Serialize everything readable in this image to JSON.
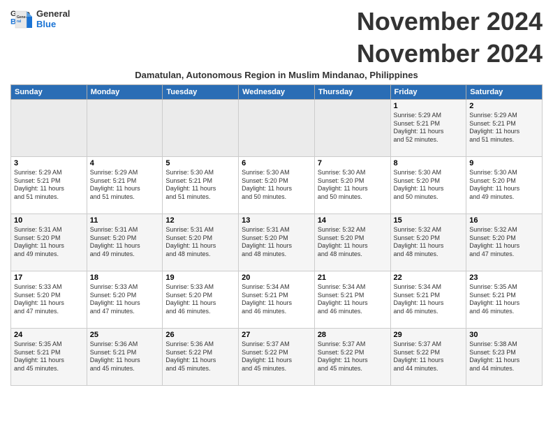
{
  "header": {
    "logo_general": "General",
    "logo_blue": "Blue",
    "month_title": "November 2024",
    "subtitle": "Damatulan, Autonomous Region in Muslim Mindanao, Philippines"
  },
  "weekdays": [
    "Sunday",
    "Monday",
    "Tuesday",
    "Wednesday",
    "Thursday",
    "Friday",
    "Saturday"
  ],
  "weeks": [
    [
      {
        "day": "",
        "info": ""
      },
      {
        "day": "",
        "info": ""
      },
      {
        "day": "",
        "info": ""
      },
      {
        "day": "",
        "info": ""
      },
      {
        "day": "",
        "info": ""
      },
      {
        "day": "1",
        "info": "Sunrise: 5:29 AM\nSunset: 5:21 PM\nDaylight: 11 hours\nand 52 minutes."
      },
      {
        "day": "2",
        "info": "Sunrise: 5:29 AM\nSunset: 5:21 PM\nDaylight: 11 hours\nand 51 minutes."
      }
    ],
    [
      {
        "day": "3",
        "info": "Sunrise: 5:29 AM\nSunset: 5:21 PM\nDaylight: 11 hours\nand 51 minutes."
      },
      {
        "day": "4",
        "info": "Sunrise: 5:29 AM\nSunset: 5:21 PM\nDaylight: 11 hours\nand 51 minutes."
      },
      {
        "day": "5",
        "info": "Sunrise: 5:30 AM\nSunset: 5:21 PM\nDaylight: 11 hours\nand 51 minutes."
      },
      {
        "day": "6",
        "info": "Sunrise: 5:30 AM\nSunset: 5:20 PM\nDaylight: 11 hours\nand 50 minutes."
      },
      {
        "day": "7",
        "info": "Sunrise: 5:30 AM\nSunset: 5:20 PM\nDaylight: 11 hours\nand 50 minutes."
      },
      {
        "day": "8",
        "info": "Sunrise: 5:30 AM\nSunset: 5:20 PM\nDaylight: 11 hours\nand 50 minutes."
      },
      {
        "day": "9",
        "info": "Sunrise: 5:30 AM\nSunset: 5:20 PM\nDaylight: 11 hours\nand 49 minutes."
      }
    ],
    [
      {
        "day": "10",
        "info": "Sunrise: 5:31 AM\nSunset: 5:20 PM\nDaylight: 11 hours\nand 49 minutes."
      },
      {
        "day": "11",
        "info": "Sunrise: 5:31 AM\nSunset: 5:20 PM\nDaylight: 11 hours\nand 49 minutes."
      },
      {
        "day": "12",
        "info": "Sunrise: 5:31 AM\nSunset: 5:20 PM\nDaylight: 11 hours\nand 48 minutes."
      },
      {
        "day": "13",
        "info": "Sunrise: 5:31 AM\nSunset: 5:20 PM\nDaylight: 11 hours\nand 48 minutes."
      },
      {
        "day": "14",
        "info": "Sunrise: 5:32 AM\nSunset: 5:20 PM\nDaylight: 11 hours\nand 48 minutes."
      },
      {
        "day": "15",
        "info": "Sunrise: 5:32 AM\nSunset: 5:20 PM\nDaylight: 11 hours\nand 48 minutes."
      },
      {
        "day": "16",
        "info": "Sunrise: 5:32 AM\nSunset: 5:20 PM\nDaylight: 11 hours\nand 47 minutes."
      }
    ],
    [
      {
        "day": "17",
        "info": "Sunrise: 5:33 AM\nSunset: 5:20 PM\nDaylight: 11 hours\nand 47 minutes."
      },
      {
        "day": "18",
        "info": "Sunrise: 5:33 AM\nSunset: 5:20 PM\nDaylight: 11 hours\nand 47 minutes."
      },
      {
        "day": "19",
        "info": "Sunrise: 5:33 AM\nSunset: 5:20 PM\nDaylight: 11 hours\nand 46 minutes."
      },
      {
        "day": "20",
        "info": "Sunrise: 5:34 AM\nSunset: 5:21 PM\nDaylight: 11 hours\nand 46 minutes."
      },
      {
        "day": "21",
        "info": "Sunrise: 5:34 AM\nSunset: 5:21 PM\nDaylight: 11 hours\nand 46 minutes."
      },
      {
        "day": "22",
        "info": "Sunrise: 5:34 AM\nSunset: 5:21 PM\nDaylight: 11 hours\nand 46 minutes."
      },
      {
        "day": "23",
        "info": "Sunrise: 5:35 AM\nSunset: 5:21 PM\nDaylight: 11 hours\nand 46 minutes."
      }
    ],
    [
      {
        "day": "24",
        "info": "Sunrise: 5:35 AM\nSunset: 5:21 PM\nDaylight: 11 hours\nand 45 minutes."
      },
      {
        "day": "25",
        "info": "Sunrise: 5:36 AM\nSunset: 5:21 PM\nDaylight: 11 hours\nand 45 minutes."
      },
      {
        "day": "26",
        "info": "Sunrise: 5:36 AM\nSunset: 5:22 PM\nDaylight: 11 hours\nand 45 minutes."
      },
      {
        "day": "27",
        "info": "Sunrise: 5:37 AM\nSunset: 5:22 PM\nDaylight: 11 hours\nand 45 minutes."
      },
      {
        "day": "28",
        "info": "Sunrise: 5:37 AM\nSunset: 5:22 PM\nDaylight: 11 hours\nand 45 minutes."
      },
      {
        "day": "29",
        "info": "Sunrise: 5:37 AM\nSunset: 5:22 PM\nDaylight: 11 hours\nand 44 minutes."
      },
      {
        "day": "30",
        "info": "Sunrise: 5:38 AM\nSunset: 5:23 PM\nDaylight: 11 hours\nand 44 minutes."
      }
    ]
  ]
}
